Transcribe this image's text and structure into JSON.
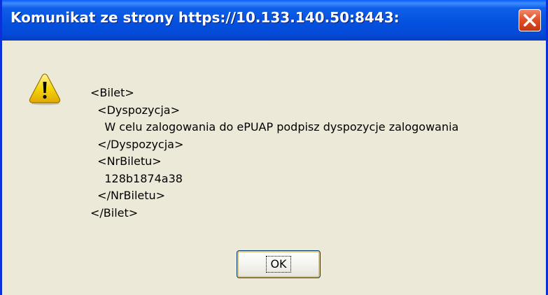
{
  "dialog": {
    "title": "Komunikat ze strony https://10.133.140.50:8443:",
    "icon": "warning-icon",
    "message": "<Bilet>\n  <Dyspozycja>\n    W celu zalogowania do ePUAP podpisz dyspozycje zalogowania\n  </Dyspozycja>\n  <NrBiletu>\n    128b1874a38\n  </NrBiletu>\n</Bilet>",
    "ok_label": "OK"
  },
  "colors": {
    "title_bar": "#0551e0",
    "window_border": "#0831d9",
    "dialog_background": "#ece9d8",
    "close_button": "#e2512a",
    "warning_yellow": "#f5d60a"
  }
}
